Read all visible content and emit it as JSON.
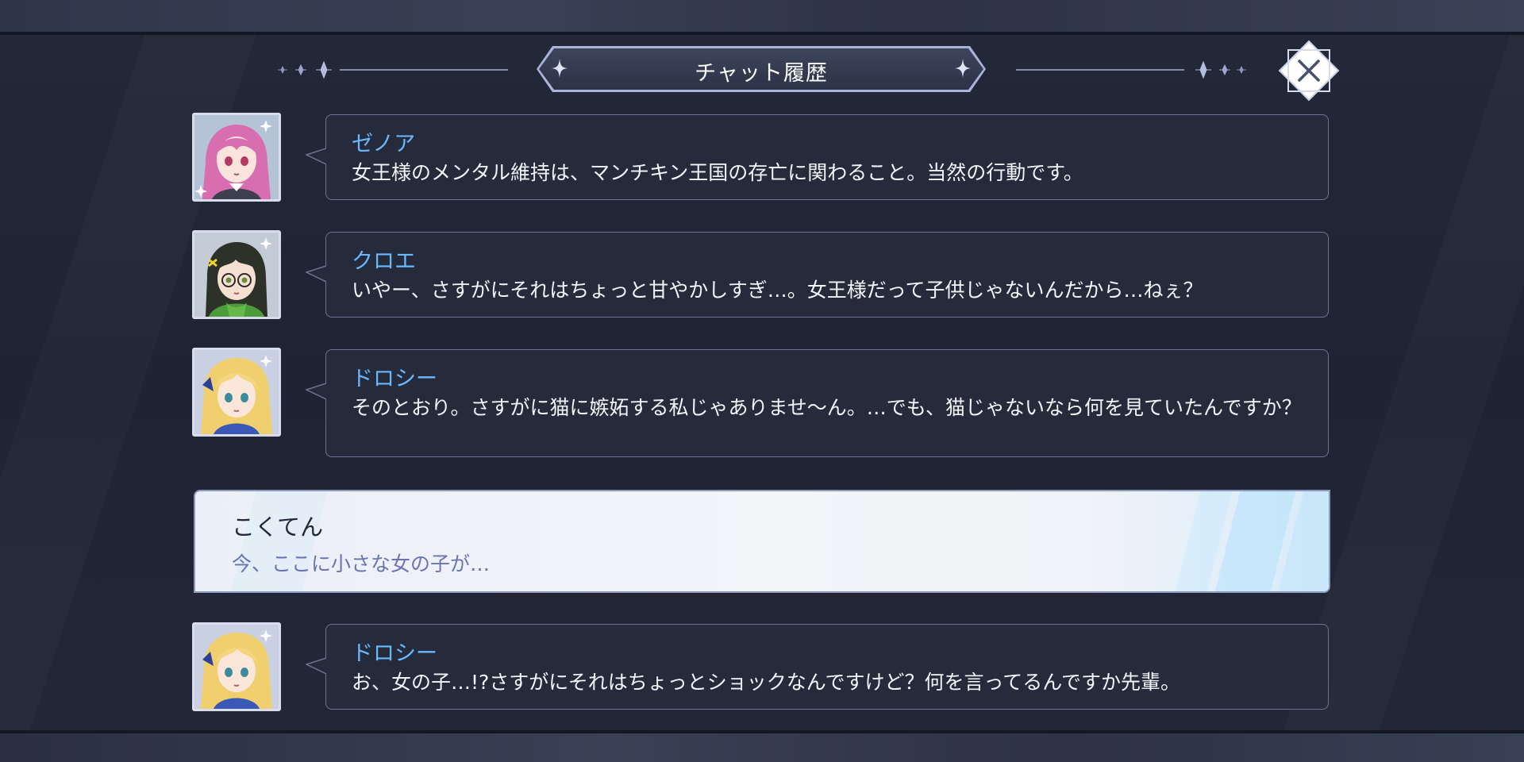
{
  "header": {
    "title": "チャット履歴",
    "close_label": "close"
  },
  "colors": {
    "speaker_name": "#6ab8ff",
    "player_message": "#6b74b3",
    "bubble_border": "#6c7390",
    "background": "#1c2030"
  },
  "messages": [
    {
      "speaker": "ゼノア",
      "text": "女王様のメンタル維持は、マンチキン王国の存亡に関わること。当然の行動です。",
      "avatar": "pink-haired-girl-avatar"
    },
    {
      "speaker": "クロエ",
      "text": "いやー、さすがにそれはちょっと甘やかしすぎ…。女王様だって子供じゃないんだから…ねぇ？",
      "avatar": "dark-haired-girl-with-glasses-avatar"
    },
    {
      "speaker": "ドロシー",
      "text": "そのとおり。さすがに猫に嫉妬する私じゃありませ～ん。…でも、猫じゃないなら何を見ていたんですか？",
      "avatar": "blonde-girl-avatar"
    }
  ],
  "player_message": {
    "speaker": "こくてん",
    "text": "今、ここに小さな女の子が…"
  },
  "last_message": {
    "speaker": "ドロシー",
    "text": "お、女の子…!?さすがにそれはちょっとショックなんですけど？何を言ってるんですか先輩。",
    "avatar": "blonde-girl-avatar"
  }
}
